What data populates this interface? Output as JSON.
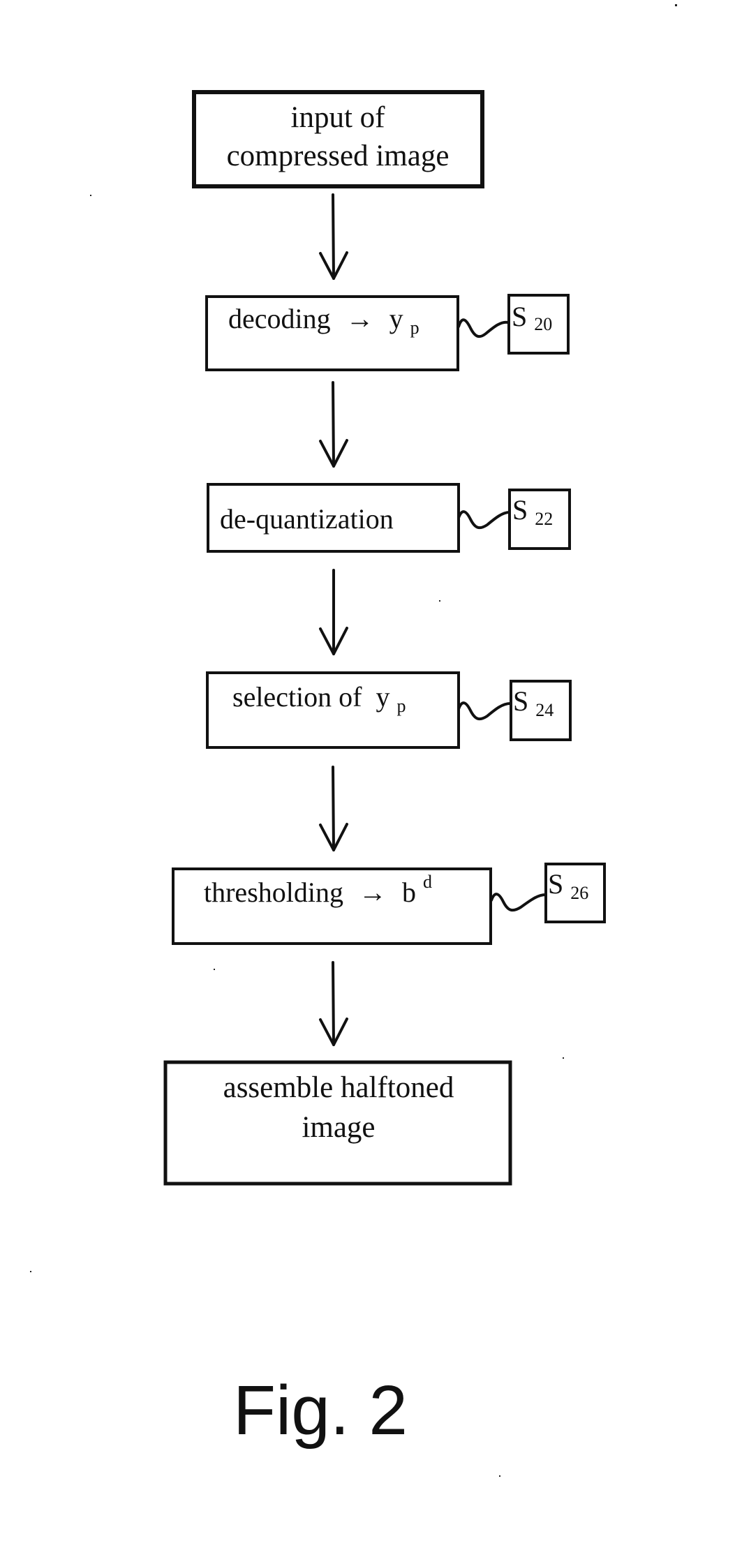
{
  "figure": {
    "caption": "Fig. 2",
    "steps": [
      {
        "id": "input",
        "lines": [
          "input of",
          "compressed image"
        ],
        "step_label": null
      },
      {
        "id": "decoding",
        "text": "decoding",
        "arrow": "→",
        "var": "y",
        "var_sub": "p",
        "var_sup": null,
        "step_label": {
          "letter": "S",
          "number": "20"
        }
      },
      {
        "id": "dequantization",
        "text": "de-quantization",
        "arrow": null,
        "var": null,
        "var_sub": null,
        "var_sup": null,
        "step_label": {
          "letter": "S",
          "number": "22"
        }
      },
      {
        "id": "selection",
        "text": "selection of",
        "arrow": null,
        "var": "y",
        "var_sub": "p",
        "var_sup": null,
        "step_label": {
          "letter": "S",
          "number": "24"
        }
      },
      {
        "id": "thresholding",
        "text": "thresholding",
        "arrow": "→",
        "var": "b",
        "var_sub": null,
        "var_sup": "d",
        "step_label": {
          "letter": "S",
          "number": "26"
        }
      },
      {
        "id": "assemble",
        "lines": [
          "assemble halftoned",
          "image"
        ],
        "step_label": null
      }
    ],
    "edges": [
      [
        "input",
        "decoding"
      ],
      [
        "decoding",
        "dequantization"
      ],
      [
        "dequantization",
        "selection"
      ],
      [
        "selection",
        "thresholding"
      ],
      [
        "thresholding",
        "assemble"
      ]
    ]
  }
}
